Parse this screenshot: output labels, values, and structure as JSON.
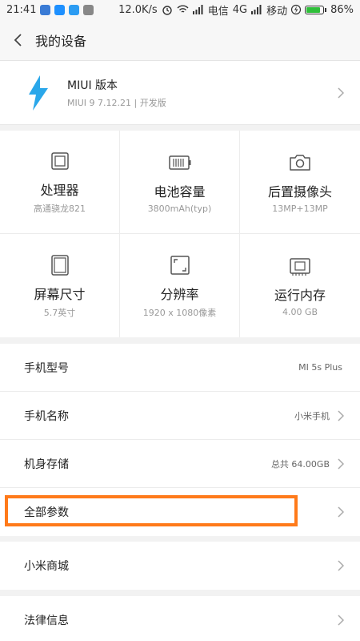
{
  "status_bar": {
    "time": "21:41",
    "speed": "12.0K/s",
    "carrier1": "电信",
    "net": "4G",
    "carrier2": "移动",
    "battery": "86%",
    "battery_level": 0.86
  },
  "header": {
    "title": "我的设备"
  },
  "miui": {
    "name": "MIUI 版本",
    "version": "MIUI 9 7.12.21 | 开发版"
  },
  "specs": [
    {
      "label": "处理器",
      "value": "高通骁龙821",
      "icon": "processor-icon"
    },
    {
      "label": "电池容量",
      "value": "3800mAh(typ)",
      "icon": "battery-icon"
    },
    {
      "label": "后置摄像头",
      "value": "13MP+13MP",
      "icon": "camera-icon"
    },
    {
      "label": "屏幕尺寸",
      "value": "5.7英寸",
      "icon": "screen-icon"
    },
    {
      "label": "分辨率",
      "value": "1920 x 1080像素",
      "icon": "resolution-icon"
    },
    {
      "label": "运行内存",
      "value": "4.00 GB",
      "icon": "memory-icon"
    }
  ],
  "rows": [
    {
      "label": "手机型号",
      "value": "MI 5s Plus"
    },
    {
      "label": "手机名称",
      "value": "小米手机"
    },
    {
      "label": "机身存储",
      "value": "总共 64.00GB"
    },
    {
      "label": "全部参数",
      "value": ""
    }
  ],
  "mall": {
    "label": "小米商城"
  },
  "legal": {
    "label": "法律信息"
  },
  "colors": {
    "highlight": "#ff7a1a",
    "miui_blue": "#2aa7ea",
    "battery_green": "#2fbf3a"
  }
}
